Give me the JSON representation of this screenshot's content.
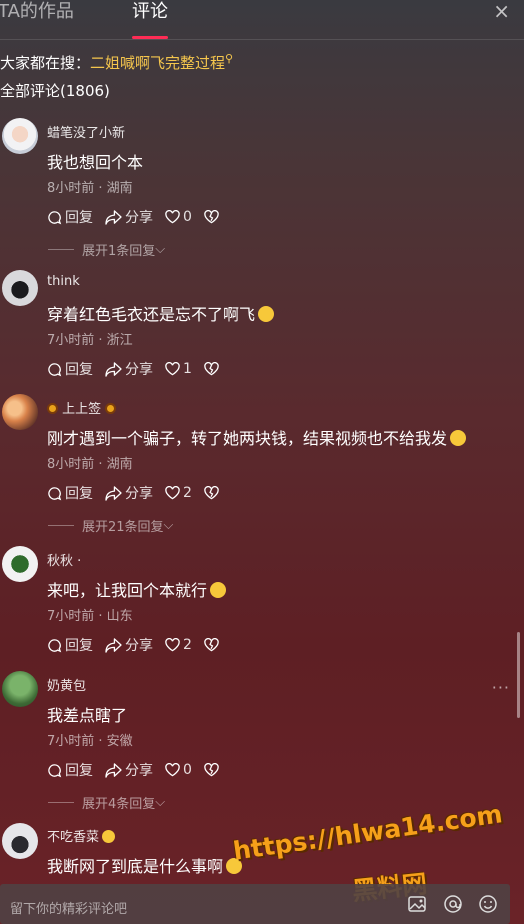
{
  "tabs": {
    "works": "TA的作品",
    "comments": "评论",
    "close": "×"
  },
  "trending": {
    "lead": "大家都在搜：",
    "query": "二姐喊啊飞完整过程"
  },
  "total": "全部评论(1806)",
  "labels": {
    "reply": "回复",
    "share": "分享",
    "dislike": ""
  },
  "comments": [
    {
      "name": "蜡笔没了小新",
      "text": "我也想回个本",
      "meta": "8小时前 · 湖南",
      "likes": "0",
      "expand": "展开1条回复"
    },
    {
      "name": "think",
      "text": "穿着红色毛衣还是忘不了啊飞",
      "meta": "7小时前 · 浙江",
      "likes": "1",
      "expand": ""
    },
    {
      "name": "上上签",
      "text": "刚才遇到一个骗子，转了她两块钱，结果视频也不给我发",
      "meta": "8小时前 · 湖南",
      "likes": "2",
      "expand": "展开21条回复"
    },
    {
      "name": "秋秋 ·",
      "text": "来吧，让我回个本就行",
      "meta": "7小时前 · 山东",
      "likes": "2",
      "expand": ""
    },
    {
      "name": "奶黄包",
      "text": "我差点瞎了",
      "meta": "7小时前 · 安徽",
      "likes": "0",
      "expand": "展开4条回复"
    },
    {
      "name": "不吃香菜",
      "text": "我断网了到底是什么事啊",
      "meta": "",
      "likes": "",
      "expand": ""
    }
  ],
  "input": {
    "placeholder": "留下你的精彩评论吧"
  },
  "watermark": {
    "line1": "https://hlwa14.com",
    "line2": "黑料网"
  },
  "colors": {
    "accent": "#fe2c55",
    "link": "#f5c64d",
    "watermark": "#f6a01a"
  }
}
